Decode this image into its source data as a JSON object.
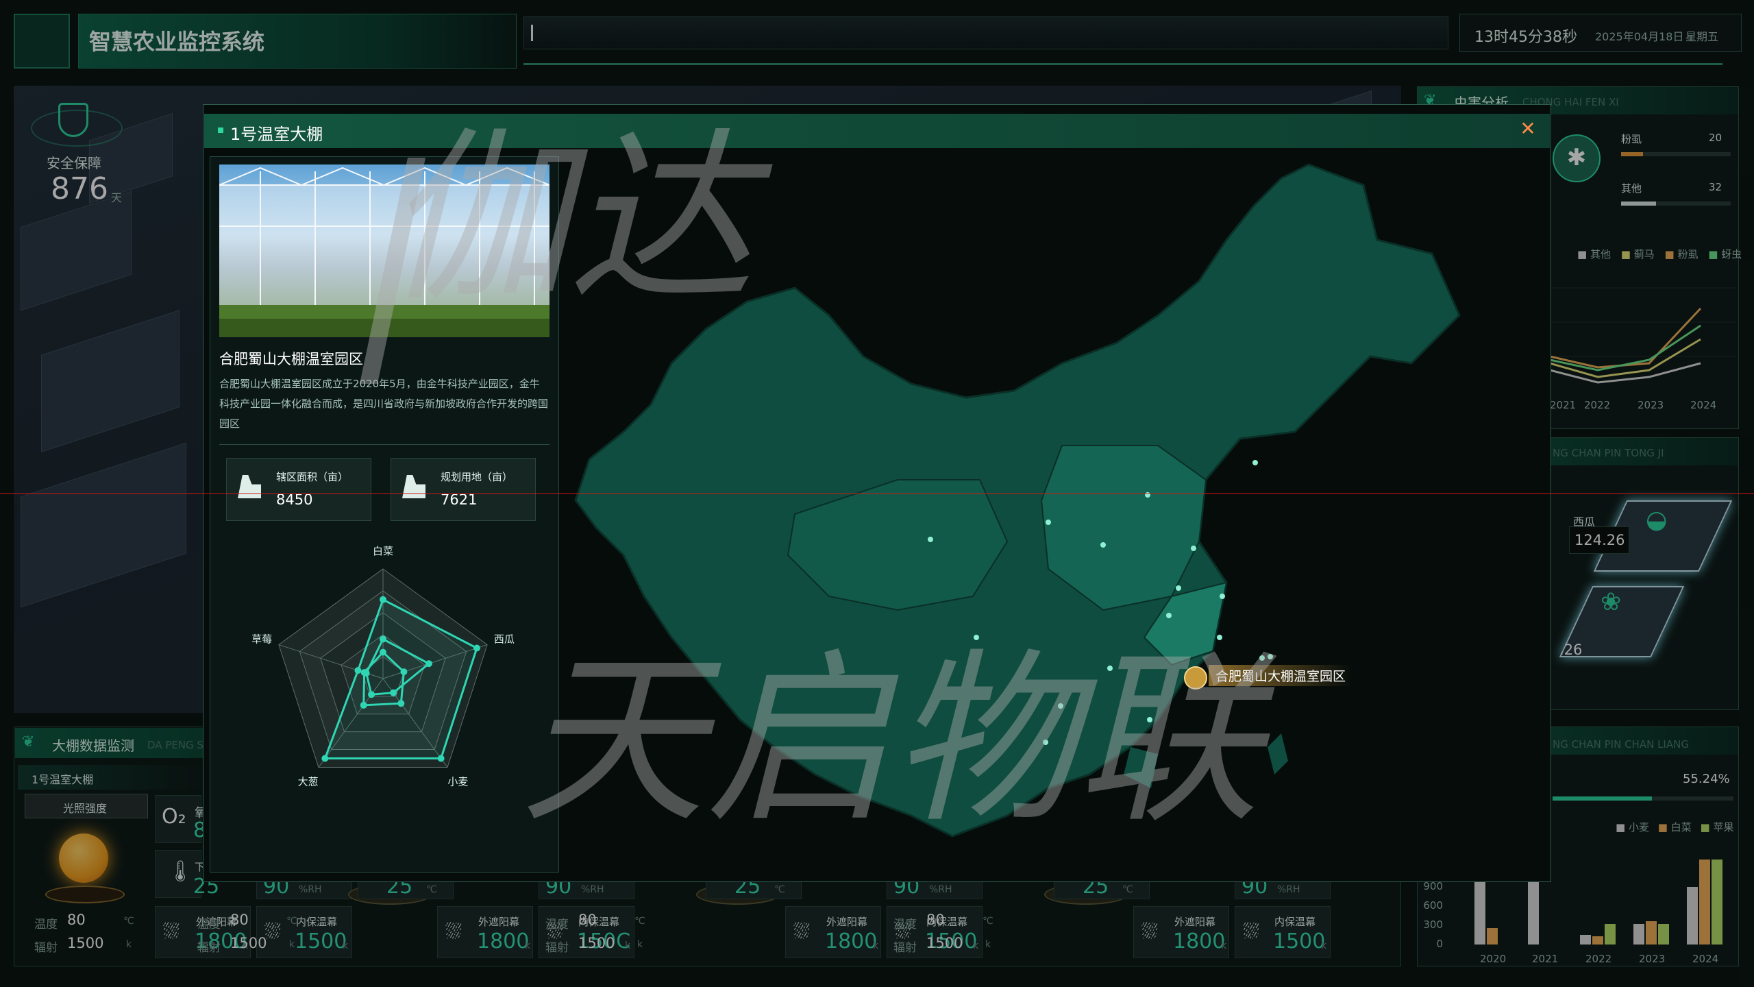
{
  "header": {
    "title": "智慧农业监控系统",
    "time": "13时45分38秒",
    "date": "2025年04月18日",
    "weekday": "星期五"
  },
  "scene": {
    "safety_label": "安全保障",
    "safety_value": "876",
    "safety_unit": "天"
  },
  "right_panels": {
    "pest": {
      "title": "虫害分析",
      "subtitle": "CHONG HAI FEN XI",
      "bars": [
        {
          "label": "粉虱",
          "value": "20",
          "level": 0.2
        },
        {
          "label": "其他",
          "value": "32",
          "level": 0.32
        }
      ],
      "legend": [
        "其他",
        "蓟马",
        "粉虱",
        "蚜虫"
      ],
      "years": [
        "2021",
        "2022",
        "2023",
        "2024"
      ]
    },
    "product": {
      "subtitle": "NG CHAN PIN TONG JI",
      "items": [
        {
          "label": "西瓜",
          "value": "124.26"
        },
        {
          "label": "",
          "value": "26"
        }
      ]
    },
    "yield": {
      "subtitle": "NG CHAN PIN CHAN LIANG",
      "percent": "55.24%",
      "progress": 0.55,
      "legend": [
        "小麦",
        "白菜",
        "苹果"
      ],
      "yticks": [
        "900",
        "600",
        "300",
        "0"
      ],
      "years": [
        "2020",
        "2021",
        "2022",
        "2023",
        "2024"
      ]
    }
  },
  "monitor": {
    "title": "大棚数据监测",
    "subtitle": "DA PENG S",
    "greenhouse": "1号温室大棚",
    "light_tab": "光照强度",
    "o2": "O₂",
    "temp_value": "25",
    "temp_unit": "℃",
    "humidity": "90",
    "humidity_unit": "%RH",
    "temp_label": "温度",
    "temp_reading": "80",
    "temp_reading_unit": "℃",
    "radiation_label": "辐射",
    "radiation_value": "1500",
    "radiation_unit": "k",
    "outer_shade": "外遮阳幕",
    "outer_value": "1800",
    "inner_shade": "内保温幕",
    "inner_value": "1500",
    "inner_value_alt": "150C",
    "unit_k": "k",
    "partial_b": "8",
    "partial_xia": "下"
  },
  "modal": {
    "title": "1号温室大棚",
    "close_icon": "close-icon",
    "park_name": "合肥蜀山大棚温室园区",
    "park_desc": "合肥蜀山大棚温室园区成立于2020年5月，由金牛科技产业园区，金牛科技产业园一体化融合而成，是四川省政府与新加坡政府合作开发的跨国园区",
    "stats": [
      {
        "label": "辖区面积（亩）",
        "value": "8450"
      },
      {
        "label": "规划用地（亩）",
        "value": "7621"
      }
    ],
    "map_marker": "合肥蜀山大棚温室园区"
  },
  "chart_data": {
    "type": "radar",
    "axes": [
      "白菜",
      "西瓜",
      "小麦",
      "大葱",
      "草莓"
    ],
    "max": 5,
    "series": [
      {
        "values": [
          3.6,
          4.5,
          4.5,
          4.5,
          1.2
        ]
      },
      {
        "values": [
          1.8,
          2.2,
          0.8,
          0.9,
          0.8
        ]
      },
      {
        "values": [
          1.2,
          1.0,
          1.4,
          1.5,
          0.9
        ]
      }
    ]
  },
  "watermarks": [
    "伽达",
    "天启物联"
  ],
  "colors": {
    "accent": "#2fd6a0",
    "modal_header": "#13563f",
    "marker": "#c89a3a"
  }
}
